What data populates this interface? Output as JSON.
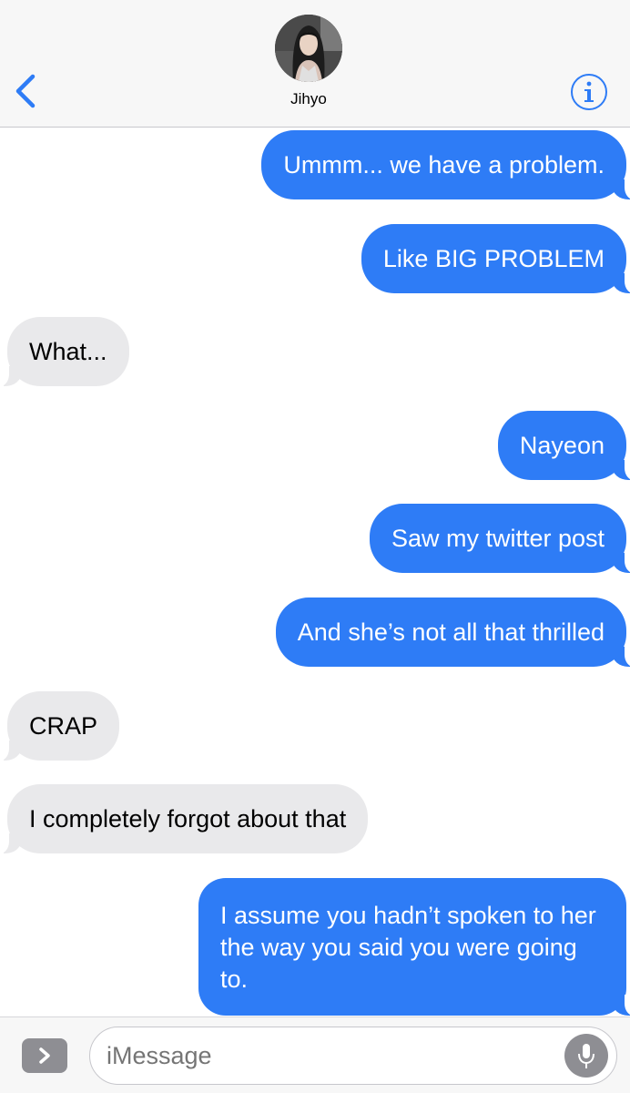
{
  "header": {
    "contact_name": "Jihyo",
    "back_icon": "chevron-left-icon",
    "info_icon": "info-icon",
    "accent_color": "#2e7cf6"
  },
  "messages": [
    {
      "side": "out",
      "text": "Ummm... we have a problem."
    },
    {
      "side": "out",
      "text": "Like BIG PROBLEM"
    },
    {
      "side": "in",
      "text": "What..."
    },
    {
      "side": "out",
      "text": "Nayeon"
    },
    {
      "side": "out",
      "text": "Saw my twitter post"
    },
    {
      "side": "out",
      "text": "And she’s not all that thrilled"
    },
    {
      "side": "in",
      "text": "CRAP"
    },
    {
      "side": "in",
      "text": "I completely forgot about that"
    },
    {
      "side": "out",
      "text": "I assume you hadn’t spoken to her the way you said you were going to."
    }
  ],
  "composer": {
    "placeholder": "iMessage",
    "apps_icon": "chevron-right-icon",
    "mic_icon": "microphone-icon"
  },
  "colors": {
    "outgoing_bubble": "#2e7cf6",
    "incoming_bubble": "#e9e9eb"
  }
}
